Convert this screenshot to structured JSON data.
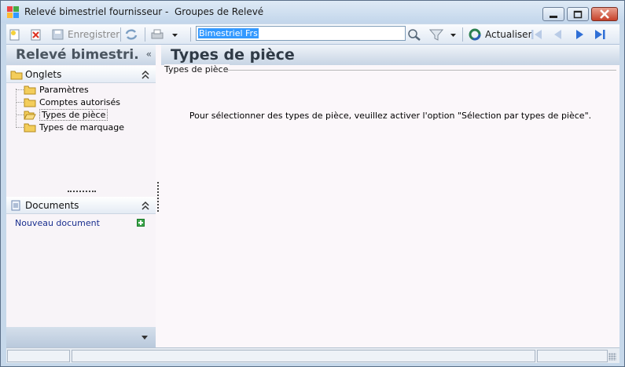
{
  "window": {
    "title": "Relevé bimestriel fournisseur -  Groupes de Relevé"
  },
  "toolbar": {
    "save_label": "Enregistrer",
    "search_value": "Bimestriel Frs",
    "refresh_label": "Actualiser",
    "icons": {
      "new": "new-document-icon",
      "delete": "delete-icon",
      "save": "save-icon",
      "sync": "sync-icon",
      "print": "printer-icon",
      "search": "magnifier-icon",
      "filter": "funnel-icon",
      "refresh": "refresh-icon",
      "first": "first-record-icon",
      "prev": "previous-record-icon",
      "next": "next-record-icon",
      "last": "last-record-icon"
    }
  },
  "left_panel": {
    "title": "Relevé bimestri.",
    "collapse_glyph": "«",
    "tabs_group": {
      "label": "Onglets",
      "items": [
        {
          "label": "Paramètres",
          "selected": false
        },
        {
          "label": "Comptes autorisés",
          "selected": false
        },
        {
          "label": "Types de pièce",
          "selected": true
        },
        {
          "label": "Types de marquage",
          "selected": false
        }
      ]
    },
    "documents_group": {
      "label": "Documents",
      "new_document": "Nouveau document"
    }
  },
  "main": {
    "title": "Types de pièce",
    "section_label": "Types de pièce",
    "info_text": "Pour sélectionner des types de pièce, veuillez activer l'option \"Sélection par types de pièce\"."
  },
  "colors": {
    "frame": "#c6d8ea",
    "header_text": "#2f3a46",
    "link": "#1a2f8f",
    "nav_arrow": "#2f6fd6"
  }
}
